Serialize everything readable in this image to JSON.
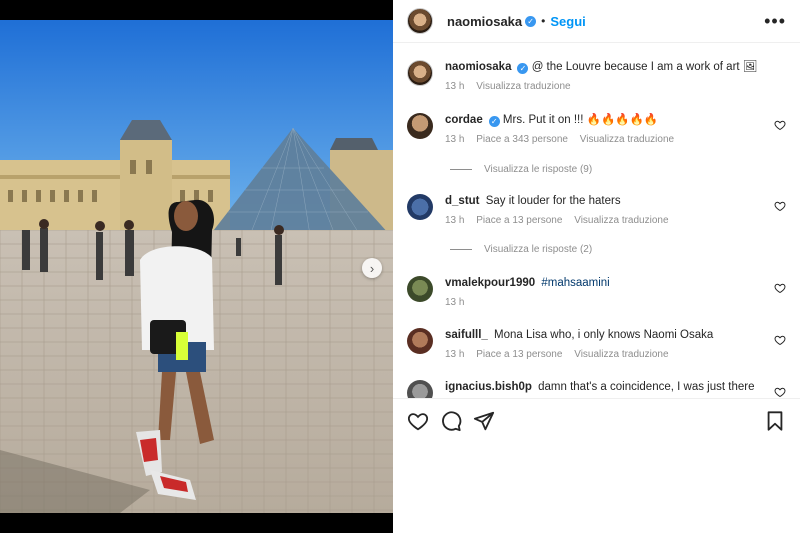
{
  "post": {
    "username": "naomiosaka",
    "follow_label": "Segui",
    "caption": "@ the Louvre because I am a work of art 🖼",
    "caption_time": "13 h",
    "caption_translate": "Visualizza traduzione"
  },
  "comments": [
    {
      "username": "cordae",
      "verified": true,
      "text": "Mrs. Put it on !!! 🔥🔥🔥🔥🔥",
      "time": "13 h",
      "likes": "Piace a 343 persone",
      "translate": "Visualizza traduzione",
      "replies": "Visualizza le risposte (9)"
    },
    {
      "username": "d_stut",
      "verified": false,
      "text": "Say it louder for the haters",
      "time": "13 h",
      "likes": "Piace a 13 persone",
      "translate": "Visualizza traduzione",
      "replies": "Visualizza le risposte (2)"
    },
    {
      "username": "vmalekpour1990",
      "verified": false,
      "text": "#mahsaamini",
      "time": "13 h"
    },
    {
      "username": "saifulll_",
      "verified": false,
      "text": "Mona Lisa who, i only knows Naomi Osaka",
      "time": "13 h",
      "likes": "Piace a 13 persone",
      "translate": "Visualizza traduzione"
    },
    {
      "username": "ignacius.bish0p",
      "verified": false,
      "text": "damn that's a coincidence, I was just there"
    }
  ],
  "icons": {
    "like": "heart-icon",
    "comment": "comment-icon",
    "share": "share-icon",
    "save": "bookmark-icon",
    "more": "more-options-icon",
    "verified": "verified-badge-icon",
    "next": "chevron-right-icon"
  },
  "colors": {
    "link": "#0095f6",
    "verified": "#3897f0",
    "muted": "#8e8e8e"
  }
}
